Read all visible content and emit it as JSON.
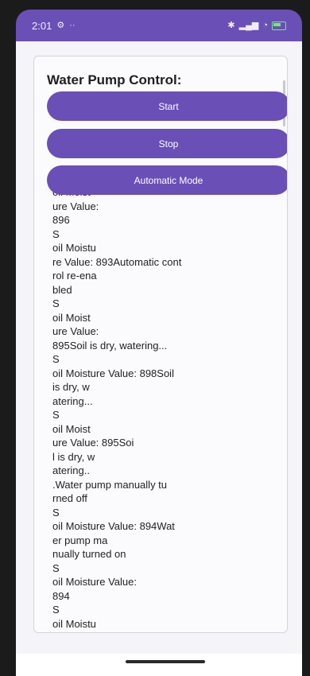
{
  "status_bar": {
    "time": "2:01",
    "left_icons": [
      "settings-icon",
      "more-dots-icon"
    ],
    "right_icons": [
      "bluetooth-icon",
      "signal-icon",
      "wifi-icon",
      "battery-icon"
    ]
  },
  "app": {
    "title": "Water Pump Control:",
    "buttons": {
      "start": "Start",
      "stop": "Stop",
      "auto": "Automatic Mode"
    },
    "log": "oil Moist\nure Value:\n896\nS\noil Moistu\nre Value: 893Automatic cont\nrol re-ena\nbled\nS\noil Moist\nure Value:\n895Soil is dry, watering...\nS\noil Moisture Value: 898Soil\nis dry, w\natering...\nS\noil Moist\nure Value: 895Soi\nl is dry, w\natering..\n.Water pump manually tu\nrned off\nS\noil Moisture Value: 894Wat\ner pump ma\nnually turned on\nS\noil Moisture Value:\n894\nS\noil Moistu"
  },
  "colors": {
    "accent": "#6a4fb6",
    "background": "#f5f4f8",
    "text": "#1f1f1f"
  }
}
